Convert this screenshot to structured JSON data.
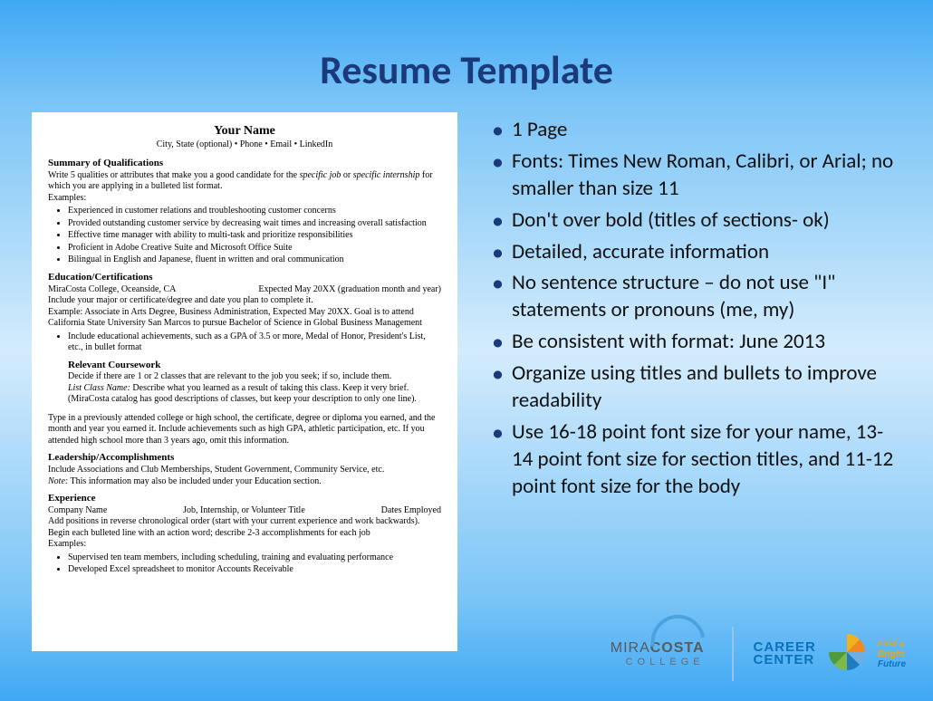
{
  "title": "Resume Template",
  "resume": {
    "name": "Your Name",
    "contact": "City, State (optional) • Phone • Email • LinkedIn",
    "summary_title": "Summary of Qualifications",
    "summary_intro_a": "Write 5 qualities or attributes that make you a good candidate for the ",
    "summary_intro_b": "specific job",
    "summary_intro_c": " or ",
    "summary_intro_d": "specific internship",
    "summary_intro_e": " for which you are applying in a bulleted list format.",
    "examples_label": "Examples:",
    "summary_bullets": [
      "Experienced in customer relations and troubleshooting customer concerns",
      "Provided outstanding customer service by decreasing wait times and increasing overall satisfaction",
      "Effective time manager with ability to multi-task and prioritize responsibilities",
      "Proficient in Adobe Creative Suite and Microsoft Office Suite",
      "Bilingual in English and Japanese, fluent in written and oral communication"
    ],
    "edu_title": "Education/Certifications",
    "edu_left": "MiraCosta College, Oceanside, CA",
    "edu_right": "Expected May 20XX (graduation month and year)",
    "edu_line2": "Include your major or certificate/degree and date you plan to complete it.",
    "edu_example": "Example: Associate in Arts Degree, Business Administration, Expected May 20XX. Goal is to attend California State University San Marcos to pursue Bachelor of Science in Global Business Management",
    "edu_bullet": "Include educational achievements, such as a GPA of 3.5 or more, Medal of Honor, President's List, etc., in bullet format",
    "rc_title": "Relevant Coursework",
    "rc_line1": "Decide if there are 1 or 2 classes that are relevant to the job you seek; if so, include them.",
    "rc_list_label": "List Class Name:",
    "rc_line2": " Describe what you learned as a result of taking this class. Keep it very brief. (MiraCosta catalog has good descriptions of classes, but keep your description to only one line).",
    "prev_college": "Type in a previously attended college or high school, the certificate, degree or diploma you earned, and the month and year you earned it. Include achievements such as high GPA, athletic participation, etc. If you attended high school more than 3 years ago, omit this information.",
    "lead_title": "Leadership/Accomplishments",
    "lead_line1": "Include Associations and Club Memberships, Student Government, Community Service, etc.",
    "lead_note": "Note:",
    "lead_line2": " This information may also be included under your Education section.",
    "exp_title": "Experience",
    "exp_company": "Company Name",
    "exp_job": "Job, Internship, or Volunteer Title",
    "exp_dates": "Dates Employed",
    "exp_desc": "Add positions in reverse chronological order (start with your current experience and work backwards). Begin each bulleted line with an action word; describe 2-3 accomplishments for each job",
    "exp_examples_label": "Examples:",
    "exp_bullets": [
      "Supervised ten team members, including scheduling, training and evaluating performance",
      "Developed Excel spreadsheet to monitor Accounts Receivable"
    ]
  },
  "tips": [
    "1 Page",
    "Fonts: Times New Roman, Calibri, or Arial; no smaller than size 11",
    "Don't over bold (titles of sections- ok)",
    "Detailed, accurate information",
    "No sentence structure – do not use \"I\" statements or pronouns (me, my)",
    "Be consistent with format: June 2013",
    "Organize using titles and bullets to improve readability",
    "Use 16-18 point font size for your name, 13-14 point font size for section titles, and 11-12 point font size for the body"
  ],
  "logos": {
    "mc1a": "MIRA",
    "mc1b": "COSTA",
    "mc2": "COLLEGE",
    "cc1": "CAREER",
    "cc2": "CENTER",
    "tag1": "Find a",
    "tag2": "Bright",
    "tag3": "Future"
  }
}
